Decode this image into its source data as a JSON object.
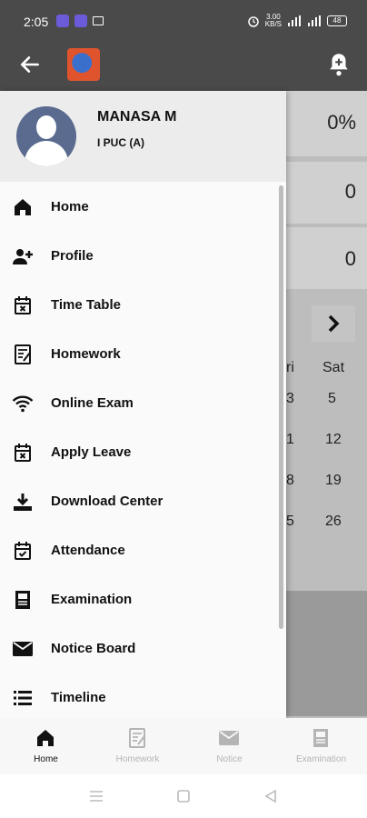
{
  "status": {
    "time": "2:05",
    "speed_top": "3.00",
    "speed_bottom": "KB/S",
    "battery": "48"
  },
  "background": {
    "stat1": "0%",
    "stat2": "0",
    "stat3": "0",
    "cal_row": [
      "ri",
      "Sat"
    ],
    "cal_rows": [
      [
        "3",
        "5"
      ],
      [
        "1",
        "12"
      ],
      [
        "8",
        "19"
      ],
      [
        "5",
        "26"
      ]
    ]
  },
  "drawer": {
    "name": "MANASA M",
    "class": "I PUC (A)",
    "items": [
      {
        "label": "Home",
        "icon": "home-icon"
      },
      {
        "label": "Profile",
        "icon": "add-person-icon"
      },
      {
        "label": "Time Table",
        "icon": "calendar-x-icon"
      },
      {
        "label": "Homework",
        "icon": "homework-icon"
      },
      {
        "label": "Online Exam",
        "icon": "wifi-icon"
      },
      {
        "label": "Apply Leave",
        "icon": "calendar-x-icon"
      },
      {
        "label": "Download Center",
        "icon": "download-icon"
      },
      {
        "label": "Attendance",
        "icon": "calendar-check-icon"
      },
      {
        "label": "Examination",
        "icon": "exam-icon"
      },
      {
        "label": "Notice Board",
        "icon": "mail-icon"
      },
      {
        "label": "Timeline",
        "icon": "list-icon"
      }
    ]
  },
  "bottom_nav": [
    {
      "label": "Home",
      "active": true
    },
    {
      "label": "Homework",
      "active": false
    },
    {
      "label": "Notice",
      "active": false
    },
    {
      "label": "Examination",
      "active": false
    }
  ],
  "colors": {
    "appbar": "#4a4a4a",
    "active": "#111111",
    "inactive": "#b5b5b5"
  }
}
